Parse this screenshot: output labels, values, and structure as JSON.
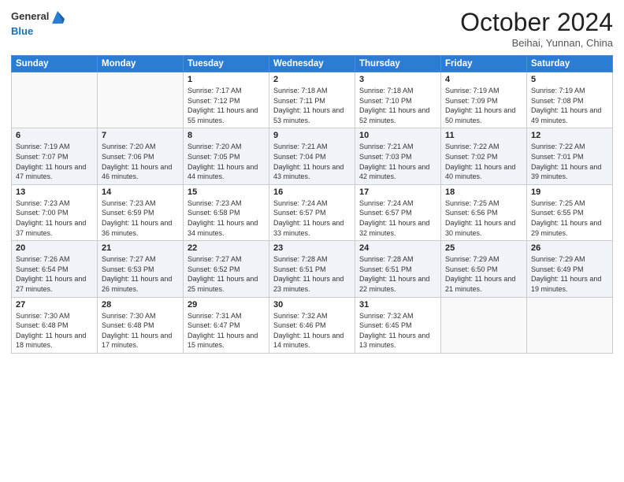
{
  "header": {
    "logo_general": "General",
    "logo_blue": "Blue",
    "title": "October 2024",
    "location": "Beihai, Yunnan, China"
  },
  "weekdays": [
    "Sunday",
    "Monday",
    "Tuesday",
    "Wednesday",
    "Thursday",
    "Friday",
    "Saturday"
  ],
  "rows": [
    [
      {
        "day": "",
        "info": ""
      },
      {
        "day": "",
        "info": ""
      },
      {
        "day": "1",
        "info": "Sunrise: 7:17 AM\nSunset: 7:12 PM\nDaylight: 11 hours and 55 minutes."
      },
      {
        "day": "2",
        "info": "Sunrise: 7:18 AM\nSunset: 7:11 PM\nDaylight: 11 hours and 53 minutes."
      },
      {
        "day": "3",
        "info": "Sunrise: 7:18 AM\nSunset: 7:10 PM\nDaylight: 11 hours and 52 minutes."
      },
      {
        "day": "4",
        "info": "Sunrise: 7:19 AM\nSunset: 7:09 PM\nDaylight: 11 hours and 50 minutes."
      },
      {
        "day": "5",
        "info": "Sunrise: 7:19 AM\nSunset: 7:08 PM\nDaylight: 11 hours and 49 minutes."
      }
    ],
    [
      {
        "day": "6",
        "info": "Sunrise: 7:19 AM\nSunset: 7:07 PM\nDaylight: 11 hours and 47 minutes."
      },
      {
        "day": "7",
        "info": "Sunrise: 7:20 AM\nSunset: 7:06 PM\nDaylight: 11 hours and 46 minutes."
      },
      {
        "day": "8",
        "info": "Sunrise: 7:20 AM\nSunset: 7:05 PM\nDaylight: 11 hours and 44 minutes."
      },
      {
        "day": "9",
        "info": "Sunrise: 7:21 AM\nSunset: 7:04 PM\nDaylight: 11 hours and 43 minutes."
      },
      {
        "day": "10",
        "info": "Sunrise: 7:21 AM\nSunset: 7:03 PM\nDaylight: 11 hours and 42 minutes."
      },
      {
        "day": "11",
        "info": "Sunrise: 7:22 AM\nSunset: 7:02 PM\nDaylight: 11 hours and 40 minutes."
      },
      {
        "day": "12",
        "info": "Sunrise: 7:22 AM\nSunset: 7:01 PM\nDaylight: 11 hours and 39 minutes."
      }
    ],
    [
      {
        "day": "13",
        "info": "Sunrise: 7:23 AM\nSunset: 7:00 PM\nDaylight: 11 hours and 37 minutes."
      },
      {
        "day": "14",
        "info": "Sunrise: 7:23 AM\nSunset: 6:59 PM\nDaylight: 11 hours and 36 minutes."
      },
      {
        "day": "15",
        "info": "Sunrise: 7:23 AM\nSunset: 6:58 PM\nDaylight: 11 hours and 34 minutes."
      },
      {
        "day": "16",
        "info": "Sunrise: 7:24 AM\nSunset: 6:57 PM\nDaylight: 11 hours and 33 minutes."
      },
      {
        "day": "17",
        "info": "Sunrise: 7:24 AM\nSunset: 6:57 PM\nDaylight: 11 hours and 32 minutes."
      },
      {
        "day": "18",
        "info": "Sunrise: 7:25 AM\nSunset: 6:56 PM\nDaylight: 11 hours and 30 minutes."
      },
      {
        "day": "19",
        "info": "Sunrise: 7:25 AM\nSunset: 6:55 PM\nDaylight: 11 hours and 29 minutes."
      }
    ],
    [
      {
        "day": "20",
        "info": "Sunrise: 7:26 AM\nSunset: 6:54 PM\nDaylight: 11 hours and 27 minutes."
      },
      {
        "day": "21",
        "info": "Sunrise: 7:27 AM\nSunset: 6:53 PM\nDaylight: 11 hours and 26 minutes."
      },
      {
        "day": "22",
        "info": "Sunrise: 7:27 AM\nSunset: 6:52 PM\nDaylight: 11 hours and 25 minutes."
      },
      {
        "day": "23",
        "info": "Sunrise: 7:28 AM\nSunset: 6:51 PM\nDaylight: 11 hours and 23 minutes."
      },
      {
        "day": "24",
        "info": "Sunrise: 7:28 AM\nSunset: 6:51 PM\nDaylight: 11 hours and 22 minutes."
      },
      {
        "day": "25",
        "info": "Sunrise: 7:29 AM\nSunset: 6:50 PM\nDaylight: 11 hours and 21 minutes."
      },
      {
        "day": "26",
        "info": "Sunrise: 7:29 AM\nSunset: 6:49 PM\nDaylight: 11 hours and 19 minutes."
      }
    ],
    [
      {
        "day": "27",
        "info": "Sunrise: 7:30 AM\nSunset: 6:48 PM\nDaylight: 11 hours and 18 minutes."
      },
      {
        "day": "28",
        "info": "Sunrise: 7:30 AM\nSunset: 6:48 PM\nDaylight: 11 hours and 17 minutes."
      },
      {
        "day": "29",
        "info": "Sunrise: 7:31 AM\nSunset: 6:47 PM\nDaylight: 11 hours and 15 minutes."
      },
      {
        "day": "30",
        "info": "Sunrise: 7:32 AM\nSunset: 6:46 PM\nDaylight: 11 hours and 14 minutes."
      },
      {
        "day": "31",
        "info": "Sunrise: 7:32 AM\nSunset: 6:45 PM\nDaylight: 11 hours and 13 minutes."
      },
      {
        "day": "",
        "info": ""
      },
      {
        "day": "",
        "info": ""
      }
    ]
  ]
}
